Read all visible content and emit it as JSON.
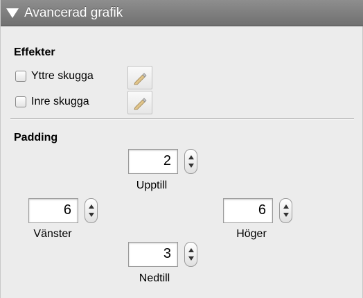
{
  "header": {
    "title": "Avancerad grafik"
  },
  "effects": {
    "label": "Effekter",
    "items": [
      {
        "label": "Yttre skugga",
        "checked": false,
        "edit_icon": "pencil-icon"
      },
      {
        "label": "Inre skugga",
        "checked": false,
        "edit_icon": "pencil-icon"
      }
    ]
  },
  "padding": {
    "label": "Padding",
    "top": {
      "value": "2",
      "label": "Upptill"
    },
    "left": {
      "value": "6",
      "label": "Vänster"
    },
    "right": {
      "value": "6",
      "label": "Höger"
    },
    "bottom": {
      "value": "3",
      "label": "Nedtill"
    }
  },
  "colors": {
    "header_bg": "#7f7f7f",
    "panel_bg": "#ececec",
    "pencil": "#e0c48a"
  }
}
